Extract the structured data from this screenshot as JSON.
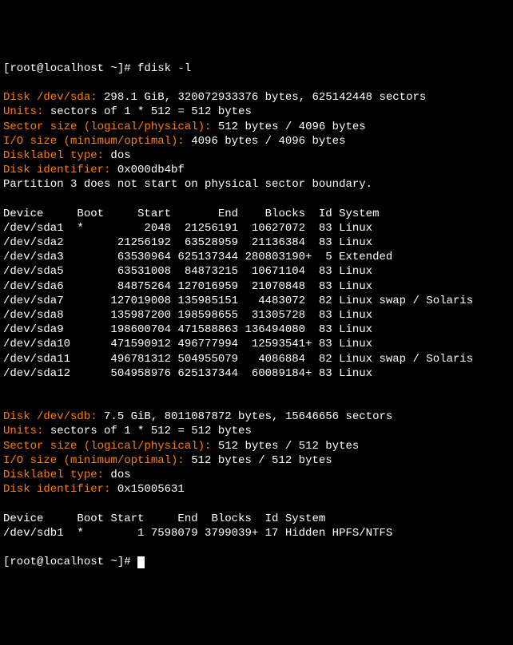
{
  "prompt1": "[root@localhost ~]# fdisk -l",
  "blank": "",
  "sda": {
    "diskLabel": "Disk /dev/sda:",
    "diskRest": " 298.1 GiB, 320072933376 bytes, 625142448 sectors",
    "unitsLabel": "Units:",
    "unitsRest": " sectors of 1 * 512 = 512 bytes",
    "sectorLabel": "Sector size (logical/physical):",
    "sectorRest": " 512 bytes / 4096 bytes",
    "ioLabel": "I/O size (minimum/optimal):",
    "ioRest": " 4096 bytes / 4096 bytes",
    "dltLabel": "Disklabel type:",
    "dltRest": " dos",
    "diLabel": "Disk identifier:",
    "diRest": " 0x000db4bf",
    "partWarn": "Partition 3 does not start on physical sector boundary.",
    "header": "Device     Boot     Start       End    Blocks  Id System",
    "rows": [
      "/dev/sda1  *         2048  21256191  10627072  83 Linux",
      "/dev/sda2        21256192  63528959  21136384  83 Linux",
      "/dev/sda3        63530964 625137344 280803190+  5 Extended",
      "/dev/sda5        63531008  84873215  10671104  83 Linux",
      "/dev/sda6        84875264 127016959  21070848  83 Linux",
      "/dev/sda7       127019008 135985151   4483072  82 Linux swap / Solaris",
      "/dev/sda8       135987200 198598655  31305728  83 Linux",
      "/dev/sda9       198600704 471588863 136494080  83 Linux",
      "/dev/sda10      471590912 496777994  12593541+ 83 Linux",
      "/dev/sda11      496781312 504955079   4086884  82 Linux swap / Solaris",
      "/dev/sda12      504958976 625137344  60089184+ 83 Linux"
    ]
  },
  "sdb": {
    "diskLabel": "Disk /dev/sdb:",
    "diskRest": " 7.5 GiB, 8011087872 bytes, 15646656 sectors",
    "unitsLabel": "Units:",
    "unitsRest": " sectors of 1 * 512 = 512 bytes",
    "sectorLabel": "Sector size (logical/physical):",
    "sectorRest": " 512 bytes / 512 bytes",
    "ioLabel": "I/O size (minimum/optimal):",
    "ioRest": " 512 bytes / 512 bytes",
    "dltLabel": "Disklabel type:",
    "dltRest": " dos",
    "diLabel": "Disk identifier:",
    "diRest": " 0x15005631",
    "header": "Device     Boot Start     End  Blocks  Id System",
    "rows": [
      "/dev/sdb1  *        1 7598079 3799039+ 17 Hidden HPFS/NTFS"
    ]
  },
  "prompt2": "[root@localhost ~]# "
}
